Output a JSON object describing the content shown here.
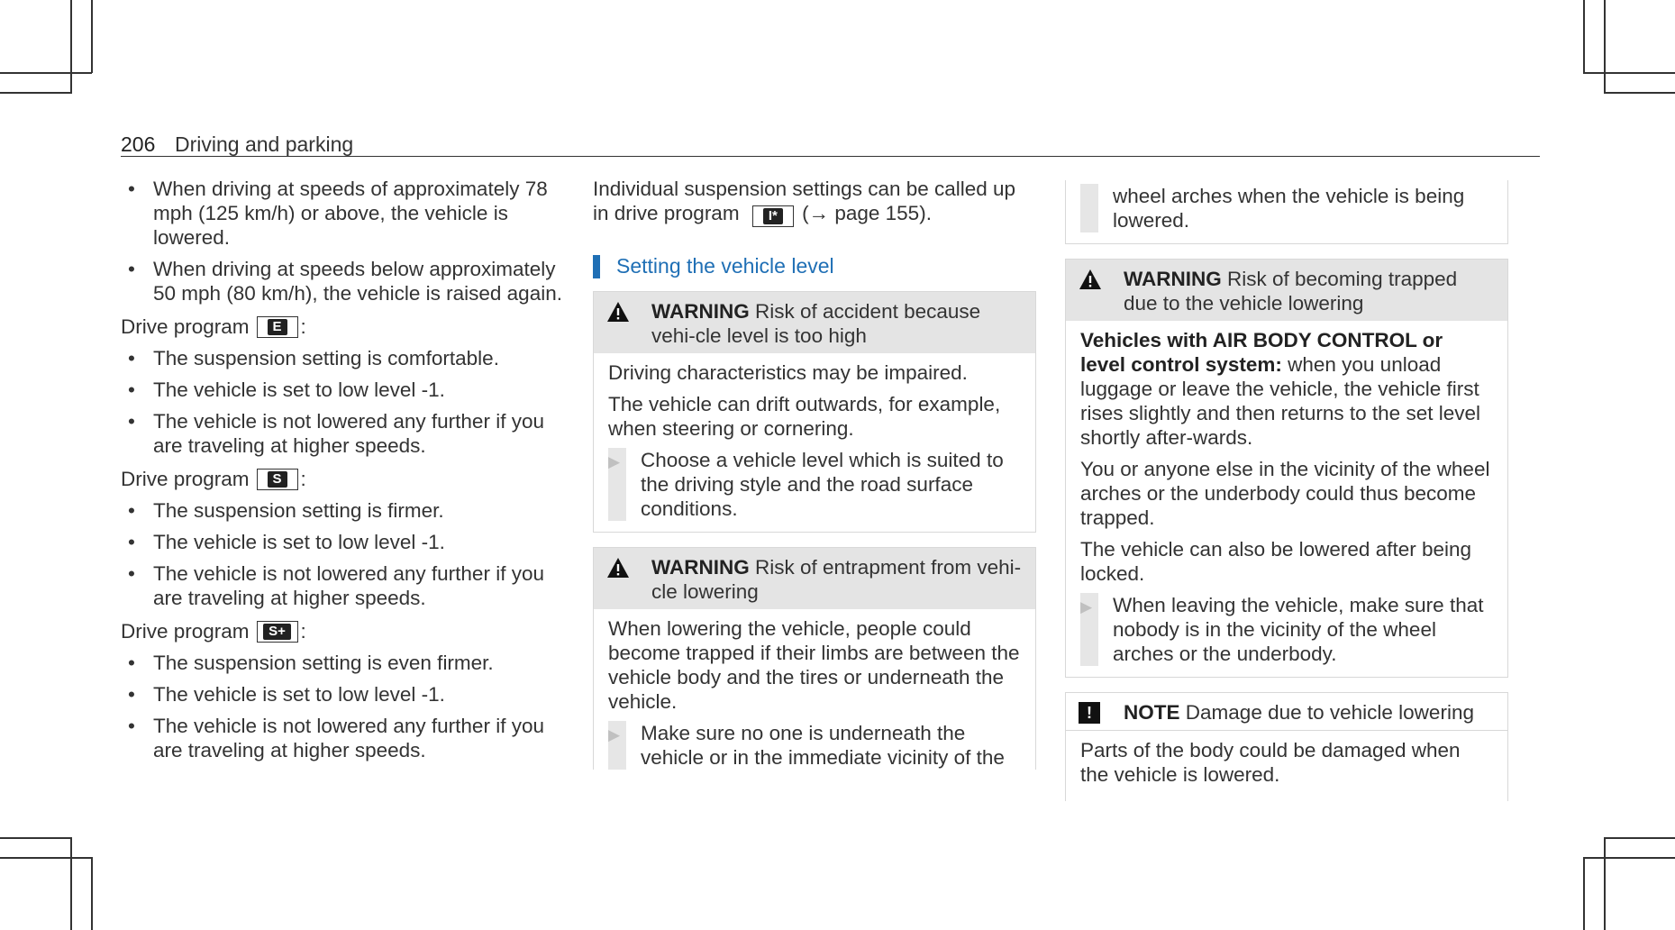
{
  "header": {
    "page_number": "206",
    "section": "Driving and parking"
  },
  "col1": {
    "intro_bullets": [
      "When driving at speeds of approximately 78 mph (125 km/h) or above, the vehicle is lowered.",
      "When driving at speeds below approximately 50 mph (80 km/h), the vehicle is raised again."
    ],
    "programs": [
      {
        "label": "Drive program",
        "key": "E",
        "bullets": [
          "The suspension setting is comfortable.",
          "The vehicle is set to low level -1.",
          "The vehicle is not lowered any further if you are traveling at higher speeds."
        ]
      },
      {
        "label": "Drive program",
        "key": "S",
        "bullets": [
          "The suspension setting is firmer.",
          "The vehicle is set to low level -1.",
          "The vehicle is not lowered any further if you are traveling at higher speeds."
        ]
      },
      {
        "label": "Drive program",
        "key": "S+",
        "bullets": [
          "The suspension setting is even firmer.",
          "The vehicle is set to low level -1.",
          "The vehicle is not lowered any further if you are traveling at higher speeds."
        ]
      }
    ],
    "colon": ":"
  },
  "col2": {
    "intro_a": "Individual suspension settings can be called up in drive program",
    "intro_key": "I*",
    "intro_b": "(→ page 155).",
    "subheading": "Setting the vehicle level",
    "warning1": {
      "keyword": "WARNING",
      "title": "Risk of accident because vehi-cle level is too high",
      "paragraphs": [
        "Driving characteristics may be impaired.",
        "The vehicle can drift outwards, for example, when steering or cornering."
      ],
      "step": "Choose a vehicle level which is suited to the driving style and the road surface conditions."
    },
    "warning2": {
      "keyword": "WARNING",
      "title": "Risk of entrapment from vehi-cle lowering",
      "paragraphs": [
        "When lowering the vehicle, people could become trapped if their limbs are between the vehicle body and the tires or underneath the vehicle."
      ],
      "step": "Make sure no one is underneath the vehicle or in the immediate vicinity of the"
    }
  },
  "col3": {
    "cont_step": "wheel arches when the vehicle is being lowered.",
    "warning3": {
      "keyword": "WARNING",
      "title": "Risk of becoming trapped due to the vehicle lowering",
      "lead_bold": "Vehicles with AIR BODY CONTROL or level control system:",
      "lead_rest": "when you unload luggage or leave the vehicle, the vehicle first rises slightly and then returns to the set level shortly after-wards.",
      "paragraphs": [
        "You or anyone else in the vicinity of the wheel arches or the underbody could thus become trapped.",
        "The vehicle can also be lowered after being locked."
      ],
      "step": "When leaving the vehicle, make sure that nobody is in the vicinity of the wheel arches or the underbody."
    },
    "note": {
      "keyword": "NOTE",
      "title": "Damage due to vehicle lowering",
      "paragraph": "Parts of the body could be damaged when the vehicle is lowered."
    }
  }
}
